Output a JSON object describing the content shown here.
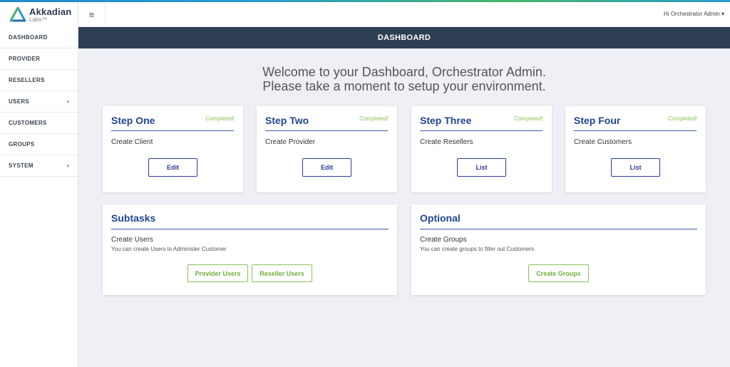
{
  "brand": {
    "name": "Akkadian",
    "sub": "Labs™",
    "logo_icon": "akkadian-triangle-logo"
  },
  "header": {
    "menu_icon": "≡",
    "user_greeting": "Hi Orchestrator Admin",
    "user_caret": "▾"
  },
  "sidebar": {
    "items": [
      {
        "label": "DASHBOARD"
      },
      {
        "label": "PROVIDER"
      },
      {
        "label": "RESELLERS"
      },
      {
        "label": "USERS",
        "caret": "‹"
      },
      {
        "label": "CUSTOMERS"
      },
      {
        "label": "GROUPS"
      },
      {
        "label": "SYSTEM",
        "caret": "‹"
      }
    ]
  },
  "banner": {
    "title": "DASHBOARD"
  },
  "welcome": {
    "line1": "Welcome to your Dashboard, Orchestrator Admin.",
    "line2": "Please take a moment to setup your environment."
  },
  "steps": [
    {
      "title": "Step One",
      "status": "Completed!",
      "text": "Create Client",
      "button": "Edit"
    },
    {
      "title": "Step Two",
      "status": "Completed!",
      "text": "Create Provider",
      "button": "Edit"
    },
    {
      "title": "Step Three",
      "status": "Completed!",
      "text": "Create Resellers",
      "button": "List"
    },
    {
      "title": "Step Four",
      "status": "Completed!",
      "text": "Create Customers",
      "button": "List"
    }
  ],
  "subtasks": {
    "title": "Subtasks",
    "text": "Create Users",
    "subtext": "You can create Users to Administer Customer",
    "buttons": [
      "Provider Users",
      "Reseller Users"
    ]
  },
  "optional": {
    "title": "Optional",
    "text": "Create Groups",
    "subtext": "You can create groups to filter out Customers",
    "button": "Create Groups"
  },
  "colors": {
    "banner": "#2e3e53",
    "title_blue": "#1f4590",
    "completed_green": "#8cc15a"
  }
}
